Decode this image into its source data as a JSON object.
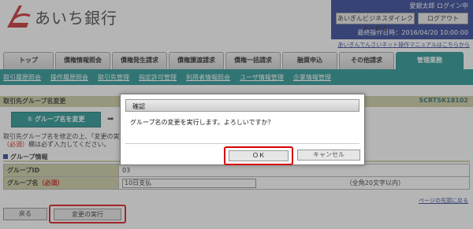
{
  "bank": {
    "name": "あいち銀行"
  },
  "user": {
    "name": "愛銀太郎 ログイン中"
  },
  "header": {
    "biz_direct": "あいぎんビジネスダイレクトへ戻る",
    "logout": "ログアウト",
    "last_login": "最終操作日時：2016/04/20 10:00:00",
    "manual_link": "あいぎんでんさいネット操作マニュアルはこちらから"
  },
  "tabs": [
    {
      "label": "トップ"
    },
    {
      "label": "債権情報照会"
    },
    {
      "label": "債権発生請求"
    },
    {
      "label": "債権譲渡請求"
    },
    {
      "label": "債権一括請求"
    },
    {
      "label": "融資申込"
    },
    {
      "label": "その他請求"
    },
    {
      "label": "管理業務"
    }
  ],
  "subnav": [
    {
      "label": "取引履歴照会"
    },
    {
      "label": "操作履歴照会"
    },
    {
      "label": "取引先管理"
    },
    {
      "label": "指定許可管理"
    },
    {
      "label": "利用者情報照会"
    },
    {
      "label": "ユーザ情報管理"
    },
    {
      "label": "企業情報管理"
    }
  ],
  "page": {
    "title": "取引先グループ名変更",
    "screen_id": "SCRTSK18102",
    "step_label": "① グループ名を変更",
    "instruction1": "取引先グループ名を修正の上、「変更の実行」",
    "instruction2_req": "（必須）",
    "instruction2_rest": "欄は必ず入力してください。",
    "section_title": "グループ情報",
    "rows": {
      "group_id_label": "グループID",
      "group_id_value": "03",
      "group_name_label": "グループ名",
      "group_name_req": "（必須）",
      "group_name_value": "10日支払",
      "group_name_hint": "（全角20文字以内）"
    },
    "top_link": "ページの先頭に戻る",
    "back_button": "戻る",
    "exec_button": "変更の実行"
  },
  "dialog": {
    "title": "確認",
    "message": "グループ名の変更を実行します。よろしいですか？",
    "ok": "ＯＫ",
    "cancel": "キャンセル"
  },
  "colors": {
    "header_blue": "#1a2f8a",
    "teal": "#0e8a88",
    "khaki": "#c9c99a",
    "highlight_red": "#d40000"
  }
}
